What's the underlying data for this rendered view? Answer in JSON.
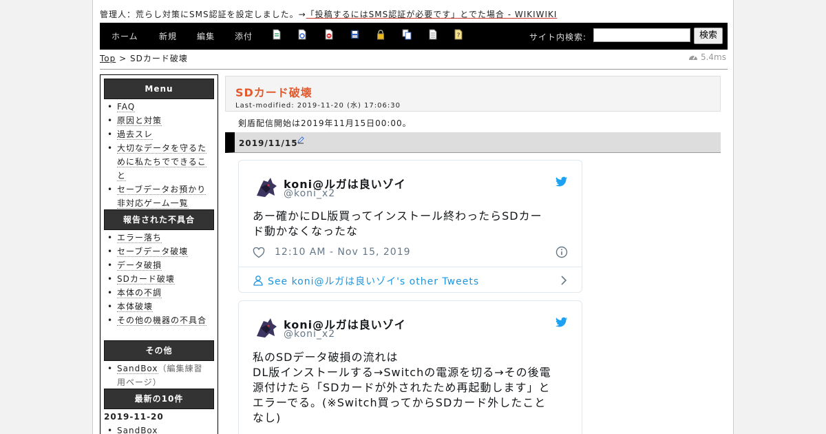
{
  "notice": {
    "prefix": "管理人：荒らし対策にSMS認証を設定しました。→",
    "link": "「投稿するにはSMS認証が必要です」とでた場合 - WIKIWIKI"
  },
  "navbar": {
    "items": [
      "ホーム",
      "新規",
      "編集",
      "添付"
    ],
    "icons": [
      "page-icon",
      "reload-icon",
      "diff-icon",
      "save-icon",
      "lock-icon",
      "copy-icon",
      "list-icon",
      "help-icon"
    ],
    "search_label": "サイト内検索:",
    "search_value": "",
    "search_button": "検索"
  },
  "breadcrumb": {
    "top": "Top",
    "sep": ">",
    "current": "SDカード破壊"
  },
  "timing": "5.4ms",
  "sidebar": {
    "menu_title": "Menu",
    "menu_items": [
      "FAQ",
      "原因と対策",
      "過去スレ",
      "大切なデータを守るために私たちでできること",
      "セーブデータお預かり非対応ゲーム一覧"
    ],
    "issues_title": "報告された不具合",
    "issues_items": [
      "エラー落ち",
      "セーブデータ破壊",
      "データ破損",
      "SDカード破壊",
      "本体の不調",
      "本体破壊",
      "その他の機器の不具合"
    ],
    "other_title": "その他",
    "other_item": "SandBox",
    "other_note": "（編集練習用ページ）",
    "recent_title": "最新の10件",
    "recent_date": "2019-11-20",
    "recent_item": "SandBox"
  },
  "page": {
    "title": "SDカード破壊",
    "last_modified": "Last-modified: 2019-11-20 (水) 17:06:30",
    "intro": "剣盾配信開始は2019年11月15日00:00。",
    "section": "2019/11/15"
  },
  "tweets": [
    {
      "name": "koni@ルガは良いゾイ",
      "handle": "@koni_x2",
      "lines": [
        "あー確かにDL版買ってインストール終わったらSDカー",
        "ド動かなくなったな"
      ],
      "time": "12:10 AM - Nov 15, 2019",
      "more": "See koni@ルガは良いゾイ's other Tweets"
    },
    {
      "name": "koni@ルガは良いゾイ",
      "handle": "@koni_x2",
      "lines": [
        "私のSDデータ破損の流れは",
        "DL版インストールする→Switchの電源を切る→その後電",
        "源付けたら「SDカードが外されたため再起動します」と",
        "エラーでる。(※Switch買ってからSDカード外したこと",
        "なし)"
      ]
    }
  ],
  "colors": {
    "title": "#e05b2e",
    "twitter": "#1da1f2",
    "link": "#1b95e0",
    "navbar": "#000000"
  }
}
